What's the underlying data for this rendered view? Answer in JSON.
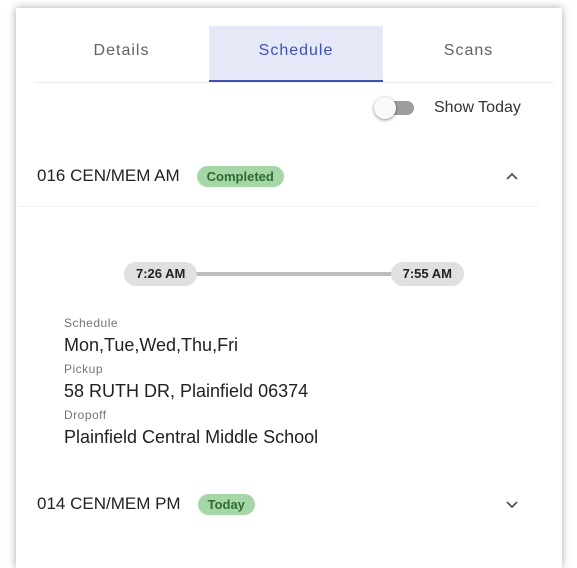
{
  "tabs": [
    {
      "label": "Details",
      "active": false
    },
    {
      "label": "Schedule",
      "active": true
    },
    {
      "label": "Scans",
      "active": false
    }
  ],
  "toggle": {
    "label": "Show Today",
    "on": false
  },
  "routes": [
    {
      "name": "016 CEN/MEM AM",
      "badge": "Completed",
      "expanded": true,
      "start_time": "7:26 AM",
      "end_time": "7:55 AM",
      "schedule_label": "Schedule",
      "schedule": "Mon,Tue,Wed,Thu,Fri",
      "pickup_label": "Pickup",
      "pickup": "58 RUTH DR, Plainfield 06374",
      "dropoff_label": "Dropoff",
      "dropoff": "Plainfield Central Middle School"
    },
    {
      "name": "014 CEN/MEM PM",
      "badge": "Today",
      "expanded": false
    }
  ],
  "icons": {
    "collapse": "chevron-up-icon",
    "expand": "chevron-down-icon"
  },
  "colors": {
    "accent": "#3f51b5",
    "active_tab_bg": "#e4e8f7",
    "badge_bg": "#a5d6a7",
    "badge_text": "#2e6b32"
  }
}
